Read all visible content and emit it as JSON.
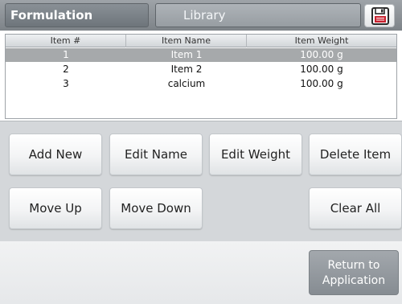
{
  "tabs": {
    "active": "Formulation",
    "inactive": "Library"
  },
  "toolbar": {
    "save_icon": "floppy-disk-icon"
  },
  "table": {
    "headers": [
      "Item #",
      "Item Name",
      "Item Weight"
    ],
    "rows": [
      {
        "num": "1",
        "name": "Item 1",
        "weight": "100.00 g",
        "selected": true
      },
      {
        "num": "2",
        "name": "Item 2",
        "weight": "100.00 g",
        "selected": false
      },
      {
        "num": "3",
        "name": "calcium",
        "weight": "100.00 g",
        "selected": false
      }
    ]
  },
  "buttons": {
    "add_new": "Add New",
    "edit_name": "Edit Name",
    "edit_weight": "Edit Weight",
    "delete_item": "Delete Item",
    "move_up": "Move Up",
    "move_down": "Move Down",
    "clear_all": "Clear All"
  },
  "footer": {
    "return_line1": "Return to",
    "return_line2": "Application"
  },
  "colors": {
    "topbar": "#8a9096",
    "selected_row": "#a6a9ab",
    "panel": "#d4d7da",
    "return_button": "#868c92"
  }
}
